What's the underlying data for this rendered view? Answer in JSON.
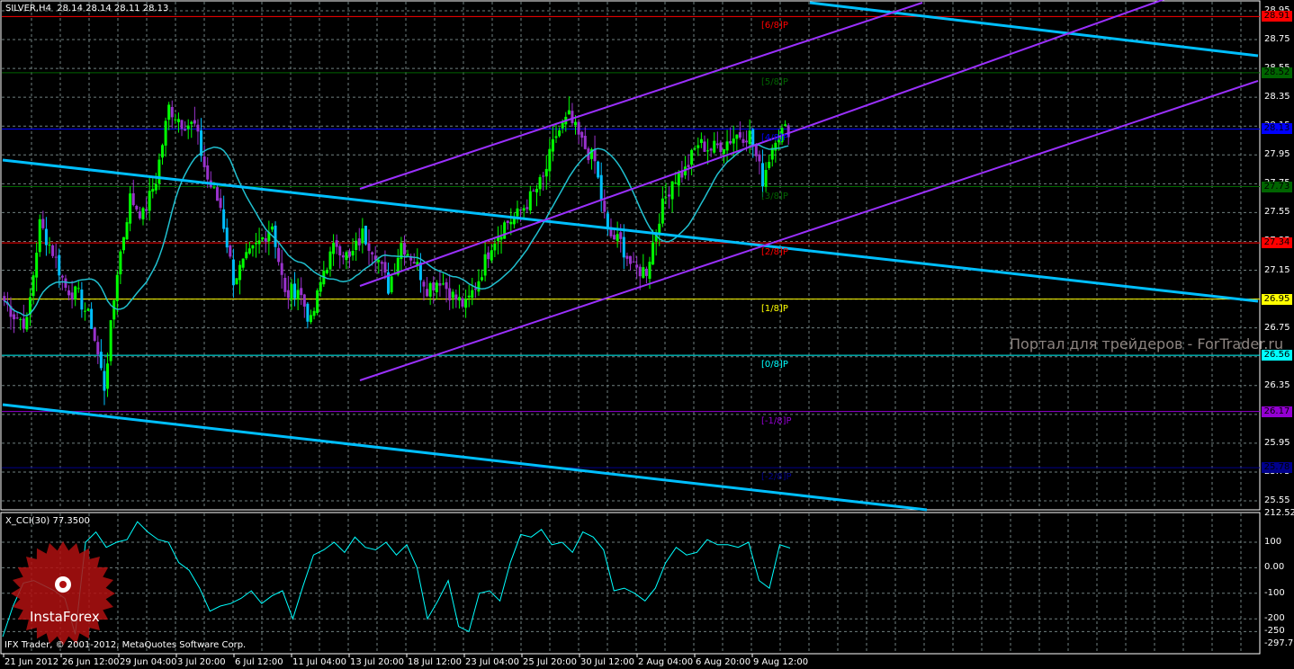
{
  "header": {
    "symbol": "SILVER,H4",
    "ohlc": "28.14 28.14 28.11 28.13"
  },
  "indicator": {
    "label": "X_CCI(30) 77.3500"
  },
  "footer": {
    "copyright": "IFX Trader, © 2001-2012, MetaQuotes Software Corp."
  },
  "watermark": "Портал для трейдеров - ForTrader.ru",
  "logo": {
    "text": "InstaForex"
  },
  "price_ticks": [
    "28.95",
    "28.75",
    "28.55",
    "28.35",
    "28.15",
    "27.95",
    "27.75",
    "27.55",
    "27.35",
    "27.15",
    "26.95",
    "26.75",
    "26.55",
    "26.35",
    "26.15",
    "25.95",
    "25.75",
    "25.55"
  ],
  "cci_ticks": [
    {
      "v": 212.523,
      "t": "212.523"
    },
    {
      "v": 100,
      "t": "100"
    },
    {
      "v": 0,
      "t": "0.00"
    },
    {
      "v": -100,
      "t": "-100"
    },
    {
      "v": -200,
      "t": "-200"
    },
    {
      "v": -250,
      "t": "-250"
    },
    {
      "v": -297.799,
      "t": "-297.799"
    }
  ],
  "time_labels": [
    "21 Jun 2012",
    "26 Jun 12:00",
    "29 Jun 04:00",
    "3 Jul 20:00",
    "6 Jul 12:00",
    "11 Jul 04:00",
    "13 Jul 20:00",
    "18 Jul 12:00",
    "23 Jul 04:00",
    "25 Jul 20:00",
    "30 Jul 12:00",
    "2 Aug 04:00",
    "6 Aug 20:00",
    "9 Aug 12:00"
  ],
  "levels": [
    {
      "price": 28.91,
      "text": "28.91",
      "label": "[6/8]P",
      "color": "#ff0000",
      "tagText": "#000"
    },
    {
      "price": 28.52,
      "text": "28.52",
      "label": "[5/8]P",
      "color": "#006400",
      "tagText": "#000"
    },
    {
      "price": 28.13,
      "text": "28.13",
      "label": "[4/8]P",
      "color": "#0000ff",
      "tagText": "#000"
    },
    {
      "price": 27.73,
      "text": "27.73",
      "label": "[3/8]P",
      "color": "#006400",
      "tagText": "#000"
    },
    {
      "price": 27.34,
      "text": "27.34",
      "label": "[2/8]P",
      "color": "#ff0000",
      "tagText": "#000"
    },
    {
      "price": 26.95,
      "text": "26.95",
      "label": "[1/8]P",
      "color": "#ffff00",
      "tagText": "#000"
    },
    {
      "price": 26.56,
      "text": "26.56",
      "label": "[0/8]P",
      "color": "#00ffff",
      "tagText": "#000"
    },
    {
      "price": 26.17,
      "text": "26.17",
      "label": "[-1/8]P",
      "color": "#9400d3",
      "tagText": "#000"
    },
    {
      "price": 25.78,
      "text": "25.78",
      "label": "[-2/8]P",
      "color": "#00008b",
      "tagText": "#000"
    }
  ],
  "chart_data": {
    "type": "candlestick",
    "title": "SILVER,H4",
    "ylim": [
      25.55,
      28.95
    ],
    "cci_ylim": [
      -297.799,
      212.523
    ],
    "closes": [
      26.97,
      26.84,
      26.78,
      27.47,
      27.28,
      27.03,
      26.97,
      26.78,
      26.34,
      27.15,
      27.65,
      27.53,
      27.78,
      28.28,
      28.18,
      28.15,
      27.78,
      27.59,
      27.09,
      27.22,
      27.34,
      27.47,
      26.97,
      27.03,
      26.78,
      27.15,
      27.34,
      27.22,
      27.4,
      27.28,
      27.03,
      27.34,
      27.22,
      27.03,
      27.09,
      26.97,
      26.9,
      27.09,
      27.34,
      27.47,
      27.53,
      27.65,
      27.78,
      28.09,
      28.21,
      28.03,
      27.9,
      27.4,
      27.34,
      27.15,
      27.15,
      27.53,
      27.78,
      27.84,
      28.03,
      27.99,
      28.03,
      28.09,
      28.09,
      27.78,
      28.09,
      28.13
    ],
    "cci": [
      -270,
      -150,
      -60,
      -50,
      -70,
      -90,
      -120,
      -260,
      100,
      140,
      80,
      100,
      110,
      180,
      140,
      110,
      100,
      20,
      -10,
      -80,
      -170,
      -150,
      -140,
      -120,
      -90,
      -140,
      -110,
      -90,
      -200,
      -70,
      50,
      70,
      100,
      60,
      120,
      80,
      70,
      100,
      50,
      90,
      0,
      -200,
      -130,
      -50,
      -230,
      -250,
      -100,
      -90,
      -130,
      20,
      130,
      120,
      150,
      90,
      100,
      60,
      140,
      120,
      70,
      -90,
      -80,
      -100,
      -130,
      -80,
      20,
      80,
      50,
      60,
      110,
      90,
      90,
      80,
      100,
      -50,
      -80,
      90,
      77
    ],
    "colors": {
      "up": "#00ff00",
      "down": "#9932cc",
      "strong_down": "#00bfff",
      "ma": "#20c0d0",
      "cci": "#00ffff",
      "trend": "#00bfff",
      "channel": "#9b30ff"
    }
  }
}
